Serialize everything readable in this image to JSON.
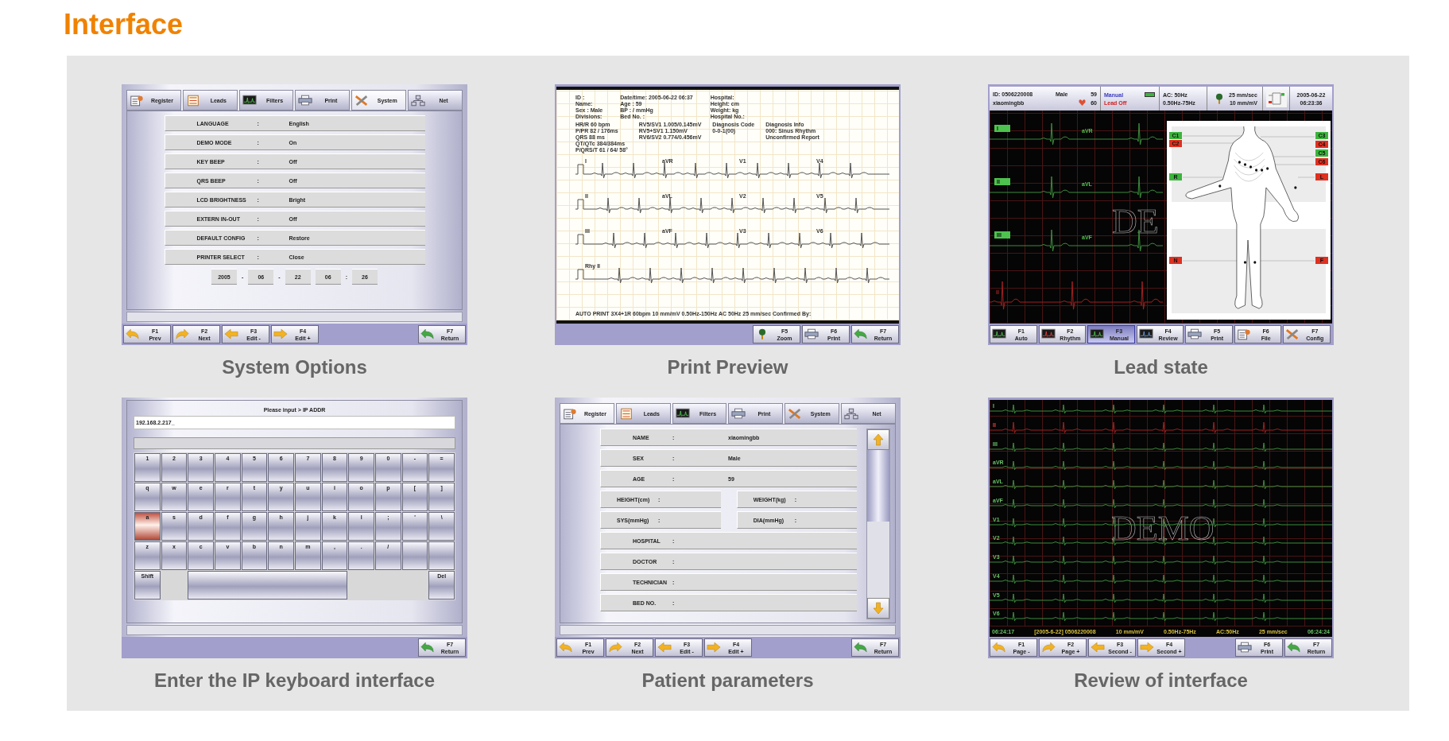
{
  "title": "Interface",
  "panels": [
    {
      "kind": "settings",
      "caption": "System Options",
      "tabs": [
        {
          "label": "Register",
          "kind": "register",
          "selected": false
        },
        {
          "label": "Leads",
          "kind": "leads",
          "selected": false
        },
        {
          "label": "Filters",
          "kind": "filters",
          "selected": false
        },
        {
          "label": "Print",
          "kind": "print",
          "selected": false
        },
        {
          "label": "System",
          "kind": "system",
          "selected": true
        },
        {
          "label": "Net",
          "kind": "net",
          "selected": false
        }
      ],
      "rows": [
        {
          "label": "LANGUAGE",
          "sep": ":",
          "value": "English"
        },
        {
          "label": "DEMO MODE",
          "sep": ":",
          "value": "On"
        },
        {
          "label": "KEY BEEP",
          "sep": ":",
          "value": "Off"
        },
        {
          "label": "QRS BEEP",
          "sep": ":",
          "value": "Off"
        },
        {
          "label": "LCD BRIGHTNESS",
          "sep": ":",
          "value": "Bright"
        },
        {
          "label": "EXTERN IN-OUT",
          "sep": ":",
          "value": "Off"
        },
        {
          "label": "DEFAULT CONFIG",
          "sep": ":",
          "value": "Restore"
        },
        {
          "label": "PRINTER SELECT",
          "sep": ":",
          "value": "Close"
        }
      ],
      "date": [
        {
          "kind": "field",
          "text": "2005"
        },
        {
          "kind": "sep",
          "text": "-"
        },
        {
          "kind": "field",
          "text": "06"
        },
        {
          "kind": "sep",
          "text": "-"
        },
        {
          "kind": "field",
          "text": "22"
        },
        {
          "kind": "field",
          "text": "06"
        },
        {
          "kind": "sep",
          "text": ":"
        },
        {
          "kind": "field",
          "text": "26"
        }
      ],
      "fkeys_left": [
        {
          "key": "F1",
          "label": "Prev",
          "kind": "prev"
        },
        {
          "key": "F2",
          "label": "Next",
          "kind": "next"
        },
        {
          "key": "F3",
          "label": "Edit -",
          "kind": "left"
        },
        {
          "key": "F4",
          "label": "Edit +",
          "kind": "right"
        }
      ],
      "fkeys_right": [
        {
          "key": "F7",
          "label": "Return",
          "kind": "return"
        }
      ]
    },
    {
      "kind": "print_preview",
      "caption": "Print Preview",
      "header": [
        [
          "ID :",
          "Name:",
          "Sex : Male",
          "Divisions:"
        ],
        [
          "Date/time: 2005-06-22 06:37",
          "Age : 59",
          "BP :    /    mmHg",
          "Bed No. :"
        ],
        [
          "Hospital:",
          "Height:      cm",
          "Weight:      kg",
          "Hospital No.:"
        ]
      ],
      "measures": [
        [
          "HR/R    60 bpm",
          "P/PR    82 / 176ms",
          "QRS     88 ms",
          "QT/QTc  384/384ms",
          "P/QRS/T  61 / 64/ 58°"
        ],
        [
          "RV5/SV1  1.005/0.145mV",
          "RV5+SV1  1.150mV",
          "RV6/SV2  0.774/0.456mV"
        ],
        [
          "Diagnosis Code",
          "0-0-1(00)"
        ],
        [
          "Diagnosis Info",
          "000: Sinus Rhythm",
          "Unconfirmed Report"
        ]
      ],
      "trace_rows": [
        {
          "labels": [
            "I",
            "aVR",
            "V1",
            "V4"
          ]
        },
        {
          "labels": [
            "II",
            "aVL",
            "V2",
            "V5"
          ]
        },
        {
          "labels": [
            "III",
            "aVF",
            "V3",
            "V6"
          ]
        },
        {
          "labels": [
            "Rhy II"
          ]
        }
      ],
      "footer": "AUTO PRINT 3X4+1R 60bpm   10 mm/mV   0.50Hz-150Hz   AC 50Hz   25 mm/sec   Confirmed By:",
      "fkeys_right": [
        {
          "key": "F5",
          "label": "Zoom",
          "kind": "zoom"
        },
        {
          "key": "F6",
          "label": "Print",
          "kind": "print"
        },
        {
          "key": "F7",
          "label": "Return",
          "kind": "return"
        }
      ]
    },
    {
      "kind": "lead_state",
      "caption": "Lead state",
      "header": {
        "id": "ID: 0506220008",
        "sex": "Male",
        "age": "59",
        "name": "xiaomingbb",
        "hr": "60",
        "mode": "Manual",
        "lead_status": "Lead Off",
        "ac": "AC: 50Hz",
        "filter": "0.50Hz-75Hz",
        "speed": "25 mm/sec",
        "gain": "10 mm/mV",
        "date": "2005-06-22",
        "time": "06:23:36"
      },
      "traces": [
        {
          "kind": "tagged",
          "label": "I",
          "label2": "aVR",
          "color": "#3c8c3c"
        },
        {
          "kind": "tagged",
          "label": "II",
          "label2": "aVL",
          "color": "#3c8c3c"
        },
        {
          "kind": "tagged",
          "label": "III",
          "label2": "aVF",
          "color": "#3c8c3c"
        },
        {
          "kind": "rhythm",
          "label": "II",
          "color": "#a02020"
        }
      ],
      "watermark": "DE",
      "tags_left": [
        {
          "label": "C1",
          "color": "#3cb43c"
        },
        {
          "label": "C2",
          "color": "#e03020"
        },
        {
          "label": "R",
          "color": "#3cb43c"
        },
        {
          "label": "N",
          "color": "#e03020"
        }
      ],
      "tags_right": [
        {
          "label": "C3",
          "color": "#3cb43c"
        },
        {
          "label": "C4",
          "color": "#e03020"
        },
        {
          "label": "C5",
          "color": "#3cb43c"
        },
        {
          "label": "C6",
          "color": "#e03020"
        },
        {
          "label": "L",
          "color": "#e03020"
        },
        {
          "label": "F",
          "color": "#e03020"
        }
      ],
      "fkeys_left": [
        {
          "key": "F1",
          "label": "Auto",
          "kind": "auto",
          "selected": false
        },
        {
          "key": "F2",
          "label": "Rhythm",
          "kind": "rhythm",
          "selected": false
        },
        {
          "key": "F3",
          "label": "Manual",
          "kind": "manual",
          "selected": true
        },
        {
          "key": "F4",
          "label": "Review",
          "kind": "review",
          "selected": false
        },
        {
          "key": "F5",
          "label": "Print",
          "kind": "print",
          "selected": false
        },
        {
          "key": "F6",
          "label": "File",
          "kind": "file",
          "selected": false
        },
        {
          "key": "F7",
          "label": "Config",
          "kind": "config",
          "selected": false
        }
      ]
    },
    {
      "kind": "keyboard",
      "caption": "Enter the IP keyboard interface",
      "prompt": "Please input > IP ADDR",
      "value": "192.168.2.217_",
      "key_rows": [
        {
          "keys": [
            {
              "label": "1",
              "selected": false
            },
            {
              "label": "2",
              "selected": false
            },
            {
              "label": "3",
              "selected": false
            },
            {
              "label": "4",
              "selected": false
            },
            {
              "label": "5",
              "selected": false
            },
            {
              "label": "6",
              "selected": false
            },
            {
              "label": "7",
              "selected": false
            },
            {
              "label": "8",
              "selected": false
            },
            {
              "label": "9",
              "selected": false
            },
            {
              "label": "0",
              "selected": false
            },
            {
              "label": "-",
              "selected": false
            },
            {
              "label": "=",
              "selected": false
            }
          ]
        },
        {
          "keys": [
            {
              "label": "q",
              "selected": false
            },
            {
              "label": "w",
              "selected": false
            },
            {
              "label": "e",
              "selected": false
            },
            {
              "label": "r",
              "selected": false
            },
            {
              "label": "t",
              "selected": false
            },
            {
              "label": "y",
              "selected": false
            },
            {
              "label": "u",
              "selected": false
            },
            {
              "label": "i",
              "selected": false
            },
            {
              "label": "o",
              "selected": false
            },
            {
              "label": "p",
              "selected": false
            },
            {
              "label": "[",
              "selected": false
            },
            {
              "label": "]",
              "selected": false
            }
          ]
        },
        {
          "keys": [
            {
              "label": "a",
              "selected": true
            },
            {
              "label": "s",
              "selected": false
            },
            {
              "label": "d",
              "selected": false
            },
            {
              "label": "f",
              "selected": false
            },
            {
              "label": "g",
              "selected": false
            },
            {
              "label": "h",
              "selected": false
            },
            {
              "label": "j",
              "selected": false
            },
            {
              "label": "k",
              "selected": false
            },
            {
              "label": "l",
              "selected": false
            },
            {
              "label": ";",
              "selected": false
            },
            {
              "label": "'",
              "selected": false
            },
            {
              "label": "\\",
              "selected": false
            }
          ]
        },
        {
          "keys": [
            {
              "label": "z",
              "selected": false
            },
            {
              "label": "x",
              "selected": false
            },
            {
              "label": "c",
              "selected": false
            },
            {
              "label": "v",
              "selected": false
            },
            {
              "label": "b",
              "selected": false
            },
            {
              "label": "n",
              "selected": false
            },
            {
              "label": "m",
              "selected": false
            },
            {
              "label": ",",
              "selected": false
            },
            {
              "label": ".",
              "selected": false
            },
            {
              "label": "/",
              "selected": false
            },
            {
              "selected": false
            },
            {
              "selected": false
            }
          ]
        },
        {
          "keys": [
            {
              "kind": "key",
              "label": "Shift",
              "selected": false
            },
            {
              "kind": "space",
              "selected": false
            },
            {
              "kind": "key",
              "label": "Del",
              "selected": false
            }
          ]
        }
      ],
      "fkeys_right": [
        {
          "key": "F7",
          "label": "Return",
          "kind": "return"
        }
      ]
    },
    {
      "kind": "patient",
      "caption": "Patient parameters",
      "tabs": [
        {
          "label": "Register",
          "kind": "register",
          "selected": true
        },
        {
          "label": "Leads",
          "kind": "leads",
          "selected": false
        },
        {
          "label": "Filters",
          "kind": "filters",
          "selected": false
        },
        {
          "label": "Print",
          "kind": "print",
          "selected": false
        },
        {
          "label": "System",
          "kind": "system",
          "selected": false
        },
        {
          "label": "Net",
          "kind": "net",
          "selected": false
        }
      ],
      "rows": [
        {
          "kind": "full",
          "cells": [
            {
              "label": "NAME",
              "sep": ":",
              "value": "xiaomingbb"
            }
          ]
        },
        {
          "kind": "full",
          "cells": [
            {
              "label": "SEX",
              "sep": ":",
              "value": "Male"
            }
          ]
        },
        {
          "kind": "full",
          "cells": [
            {
              "label": "AGE",
              "sep": ":",
              "value": "59"
            }
          ]
        },
        {
          "kind": "pair",
          "cells": [
            {
              "label": "HEIGHT(cm)",
              "sep": ":"
            },
            {
              "label": "WEIGHT(kg)",
              "sep": ":"
            }
          ]
        },
        {
          "kind": "pair",
          "cells": [
            {
              "label": "SYS(mmHg)",
              "sep": ":"
            },
            {
              "label": "DIA(mmHg)",
              "sep": ":"
            }
          ]
        },
        {
          "kind": "full",
          "cells": [
            {
              "label": "HOSPITAL",
              "sep": ":"
            }
          ]
        },
        {
          "kind": "full",
          "cells": [
            {
              "label": "DOCTOR",
              "sep": ":"
            }
          ]
        },
        {
          "kind": "full",
          "cells": [
            {
              "label": "TECHNICIAN",
              "sep": ":"
            }
          ]
        },
        {
          "kind": "full",
          "cells": [
            {
              "label": "BED NO.",
              "sep": ":"
            }
          ]
        }
      ],
      "fkeys_left": [
        {
          "key": "F1",
          "label": "Prev",
          "kind": "prev"
        },
        {
          "key": "F2",
          "label": "Next",
          "kind": "next"
        },
        {
          "key": "F3",
          "label": "Edit -",
          "kind": "left"
        },
        {
          "key": "F4",
          "label": "Edit +",
          "kind": "right"
        }
      ],
      "fkeys_right": [
        {
          "key": "F7",
          "label": "Return",
          "kind": "return"
        }
      ]
    },
    {
      "kind": "review",
      "caption": "Review of interface",
      "traces": [
        {
          "label": "I",
          "color": "#3c8c3c"
        },
        {
          "label": "II",
          "color": "#a02020"
        },
        {
          "label": "III",
          "color": "#3c8c3c"
        },
        {
          "label": "aVR",
          "color": "#3c8c3c"
        },
        {
          "label": "aVL",
          "color": "#3c8c3c"
        },
        {
          "label": "aVF",
          "color": "#3c8c3c"
        },
        {
          "label": "V1",
          "color": "#3c8c3c"
        },
        {
          "label": "V2",
          "color": "#3c8c3c"
        },
        {
          "label": "V3",
          "color": "#3c8c3c"
        },
        {
          "label": "V4",
          "color": "#3c8c3c"
        },
        {
          "label": "V5",
          "color": "#3c8c3c"
        },
        {
          "label": "V6",
          "color": "#3c8c3c"
        }
      ],
      "watermark": "DEMO",
      "footer": [
        "06:24:17",
        "[2005-6-22] 0506220008",
        "10 mm/mV",
        "0.50Hz-75Hz",
        "AC:50Hz",
        "25 mm/sec",
        "06:24:24"
      ],
      "fkeys_left": [
        {
          "key": "F1",
          "label": "Page -",
          "kind": "prev"
        },
        {
          "key": "F2",
          "label": "Page +",
          "kind": "next"
        },
        {
          "key": "F3",
          "label": "Second -",
          "kind": "left"
        },
        {
          "key": "F4",
          "label": "Second +",
          "kind": "right"
        }
      ],
      "fkeys_right": [
        {
          "key": "F6",
          "label": "Print",
          "kind": "print"
        },
        {
          "key": "F7",
          "label": "Return",
          "kind": "return"
        }
      ]
    }
  ]
}
